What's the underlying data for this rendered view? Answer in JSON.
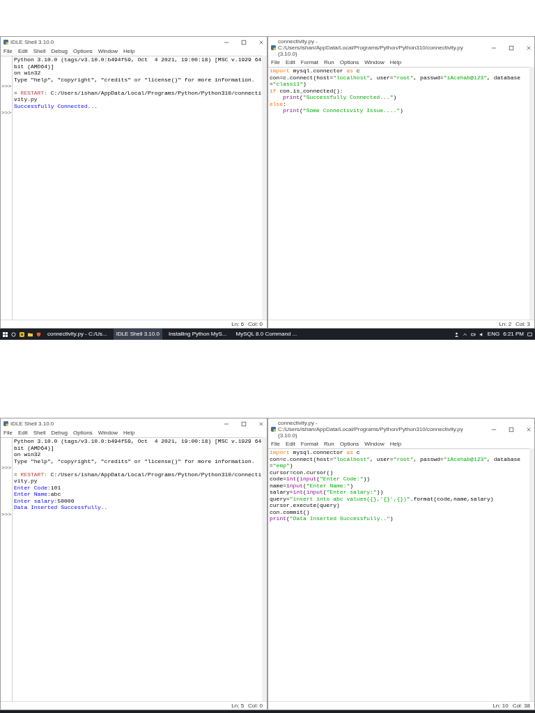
{
  "screenshots": [
    {
      "windows": [
        {
          "kind": "shell",
          "title": "IDLE Shell 3.10.0",
          "menu": [
            "File",
            "Edit",
            "Shell",
            "Debug",
            "Options",
            "Window",
            "Help"
          ],
          "lines": [
            {
              "segments": [
                {
                  "kind": "plain",
                  "text": "Python 3.10.0 (tags/v3.10.0:b494f59, Oct  4 2021, 19:00:18) [MSC v.1929 64 bit (AMD64)]"
                }
              ]
            },
            {
              "segments": [
                {
                  "kind": "plain",
                  "text": "on win32"
                }
              ]
            },
            {
              "segments": [
                {
                  "kind": "plain",
                  "text": "Type \"help\", \"copyright\", \"credits\" or \"license()\" for more information."
                }
              ]
            },
            {
              "prompt": ">>>"
            },
            {
              "segments": [
                {
                  "kind": "plain",
                  "text": "= "
                },
                {
                  "kind": "restart",
                  "text": "RESTART:"
                },
                {
                  "kind": "plain",
                  "text": " C:/Users/ishan/AppData/Local/Programs/Python/Python310/connectivity.py"
                }
              ]
            },
            {
              "segments": [
                {
                  "kind": "stdout",
                  "text": "Successfully Connected..."
                }
              ]
            },
            {
              "prompt": ">>>"
            }
          ],
          "status": {
            "line": "Ln: 6",
            "col": "Col: 0"
          }
        },
        {
          "kind": "editor",
          "title": "connectivity.py - C:/Users/ishan/AppData/Local/Programs/Python/Python310/connectivity.py (3.10.0)",
          "menu": [
            "File",
            "Edit",
            "Format",
            "Run",
            "Options",
            "Window",
            "Help"
          ],
          "lines": [
            {
              "segments": [
                {
                  "kind": "keyword",
                  "text": "import"
                },
                {
                  "kind": "plain",
                  "text": " mysql.connector "
                },
                {
                  "kind": "keyword",
                  "text": "as"
                },
                {
                  "kind": "plain",
                  "text": " c"
                }
              ]
            },
            {
              "segments": [
                {
                  "kind": "plain",
                  "text": "con=c.connect(host="
                },
                {
                  "kind": "string",
                  "text": "\"localhost\""
                },
                {
                  "kind": "plain",
                  "text": ", user="
                },
                {
                  "kind": "string",
                  "text": "\"root\""
                },
                {
                  "kind": "plain",
                  "text": ", passwd="
                },
                {
                  "kind": "string",
                  "text": "\"iAcehab@123\""
                },
                {
                  "kind": "plain",
                  "text": ", database="
                },
                {
                  "kind": "string",
                  "text": "\"class11\""
                },
                {
                  "kind": "plain",
                  "text": ")"
                }
              ]
            },
            {
              "segments": [
                {
                  "kind": "keyword",
                  "text": "if"
                },
                {
                  "kind": "plain",
                  "text": " con.is_connected():"
                }
              ]
            },
            {
              "indented": true,
              "segments": [
                {
                  "kind": "builtin",
                  "text": "print"
                },
                {
                  "kind": "plain",
                  "text": "("
                },
                {
                  "kind": "string",
                  "text": "\"Successfully Connected...\""
                },
                {
                  "kind": "plain",
                  "text": ")"
                }
              ]
            },
            {
              "segments": [
                {
                  "kind": "keyword",
                  "text": "else"
                },
                {
                  "kind": "plain",
                  "text": ":"
                }
              ]
            },
            {
              "indented": true,
              "segments": [
                {
                  "kind": "builtin",
                  "text": "print"
                },
                {
                  "kind": "plain",
                  "text": "("
                },
                {
                  "kind": "string",
                  "text": "\"Some Connectivity Issue....\""
                },
                {
                  "kind": "plain",
                  "text": ")"
                }
              ]
            }
          ],
          "status": {
            "line": "Ln: 2",
            "col": "Col: 3"
          }
        }
      ],
      "taskbar": {
        "clipped": false,
        "apps": [
          {
            "label": "connectivity.py - C:/Us...",
            "selected": false
          },
          {
            "label": "IDLE Shell 3.10.0",
            "selected": true
          },
          {
            "label": "Installing Python MyS...",
            "selected": false
          },
          {
            "label": "MySQL 8.0 Command ...",
            "selected": false
          }
        ],
        "language": "ENG",
        "time": "6:21 PM"
      }
    },
    {
      "windows": [
        {
          "kind": "shell",
          "title": "IDLE Shell 3.10.0",
          "menu": [
            "File",
            "Edit",
            "Shell",
            "Debug",
            "Options",
            "Window",
            "Help"
          ],
          "lines": [
            {
              "segments": [
                {
                  "kind": "plain",
                  "text": "Python 3.10.0 (tags/v3.10.0:b494f59, Oct  4 2021, 19:00:18) [MSC v.1929 64 bit (AMD64)]"
                }
              ]
            },
            {
              "segments": [
                {
                  "kind": "plain",
                  "text": "on win32"
                }
              ]
            },
            {
              "segments": [
                {
                  "kind": "plain",
                  "text": "Type \"help\", \"copyright\", \"credits\" or \"license()\" for more information."
                }
              ]
            },
            {
              "prompt": ">>>"
            },
            {
              "segments": [
                {
                  "kind": "plain",
                  "text": "= "
                },
                {
                  "kind": "restart",
                  "text": "RESTART:"
                },
                {
                  "kind": "plain",
                  "text": " C:/Users/ishan/AppData/Local/Programs/Python/Python310/connectivity.py"
                }
              ]
            },
            {
              "segments": [
                {
                  "kind": "stdout",
                  "text": "Enter Code:"
                },
                {
                  "kind": "plain",
                  "text": "101"
                }
              ]
            },
            {
              "segments": [
                {
                  "kind": "stdout",
                  "text": "Enter Name:"
                },
                {
                  "kind": "plain",
                  "text": "abc"
                }
              ]
            },
            {
              "segments": [
                {
                  "kind": "stdout",
                  "text": "Enter salary:"
                },
                {
                  "kind": "plain",
                  "text": "50000"
                }
              ]
            },
            {
              "segments": [
                {
                  "kind": "stdout",
                  "text": "Data Inserted Successfully.."
                }
              ]
            },
            {
              "prompt": ">>>"
            }
          ],
          "status": {
            "line": "Ln: 5",
            "col": "Col: 0"
          }
        },
        {
          "kind": "editor",
          "title": "connectivity.py - C:/Users/ishan/AppData/Local/Programs/Python/Python310/connectivity.py (3.10.0)",
          "menu": [
            "File",
            "Edit",
            "Format",
            "Run",
            "Options",
            "Window",
            "Help"
          ],
          "lines": [
            {
              "segments": [
                {
                  "kind": "keyword",
                  "text": "import"
                },
                {
                  "kind": "plain",
                  "text": " mysql.connector "
                },
                {
                  "kind": "keyword",
                  "text": "as"
                },
                {
                  "kind": "plain",
                  "text": " c"
                }
              ]
            },
            {
              "segments": [
                {
                  "kind": "plain",
                  "text": "con=c.connect(host="
                },
                {
                  "kind": "string",
                  "text": "\"localhost\""
                },
                {
                  "kind": "plain",
                  "text": ", user="
                },
                {
                  "kind": "string",
                  "text": "\"root\""
                },
                {
                  "kind": "plain",
                  "text": ", passwd="
                },
                {
                  "kind": "string",
                  "text": "\"iAcehab@123\""
                },
                {
                  "kind": "plain",
                  "text": ", database="
                },
                {
                  "kind": "string",
                  "text": "\"emp\""
                },
                {
                  "kind": "plain",
                  "text": ")"
                }
              ]
            },
            {
              "segments": [
                {
                  "kind": "plain",
                  "text": "cursor=con.cursor()"
                }
              ]
            },
            {
              "segments": [
                {
                  "kind": "plain",
                  "text": "code="
                },
                {
                  "kind": "builtin",
                  "text": "int"
                },
                {
                  "kind": "plain",
                  "text": "("
                },
                {
                  "kind": "builtin",
                  "text": "input"
                },
                {
                  "kind": "plain",
                  "text": "("
                },
                {
                  "kind": "string",
                  "text": "\"Enter Code:\""
                },
                {
                  "kind": "plain",
                  "text": "))"
                }
              ]
            },
            {
              "segments": [
                {
                  "kind": "plain",
                  "text": "name="
                },
                {
                  "kind": "builtin",
                  "text": "input"
                },
                {
                  "kind": "plain",
                  "text": "("
                },
                {
                  "kind": "string",
                  "text": "\"Enter Name:\""
                },
                {
                  "kind": "plain",
                  "text": ")"
                }
              ]
            },
            {
              "segments": [
                {
                  "kind": "plain",
                  "text": "salary="
                },
                {
                  "kind": "builtin",
                  "text": "int"
                },
                {
                  "kind": "plain",
                  "text": "("
                },
                {
                  "kind": "builtin",
                  "text": "input"
                },
                {
                  "kind": "plain",
                  "text": "("
                },
                {
                  "kind": "string",
                  "text": "\"Enter salary:\""
                },
                {
                  "kind": "plain",
                  "text": "))"
                }
              ]
            },
            {
              "segments": [
                {
                  "kind": "plain",
                  "text": "query="
                },
                {
                  "kind": "string",
                  "text": "\"insert into abc values({},'{}',{})\""
                },
                {
                  "kind": "plain",
                  "text": ".format(code,name,salary)"
                }
              ]
            },
            {
              "segments": [
                {
                  "kind": "plain",
                  "text": "cursor.execute(query)"
                }
              ]
            },
            {
              "segments": [
                {
                  "kind": "plain",
                  "text": "con.commit()"
                }
              ]
            },
            {
              "segments": [
                {
                  "kind": "builtin",
                  "text": "print"
                },
                {
                  "kind": "plain",
                  "text": "("
                },
                {
                  "kind": "string",
                  "text": "\"Data Inserted Successfully..\""
                },
                {
                  "kind": "plain",
                  "text": ")"
                }
              ]
            }
          ],
          "status": {
            "line": "Ln: 10",
            "col": "Col: 38"
          }
        }
      ],
      "taskbar": {
        "clipped": true
      }
    }
  ]
}
